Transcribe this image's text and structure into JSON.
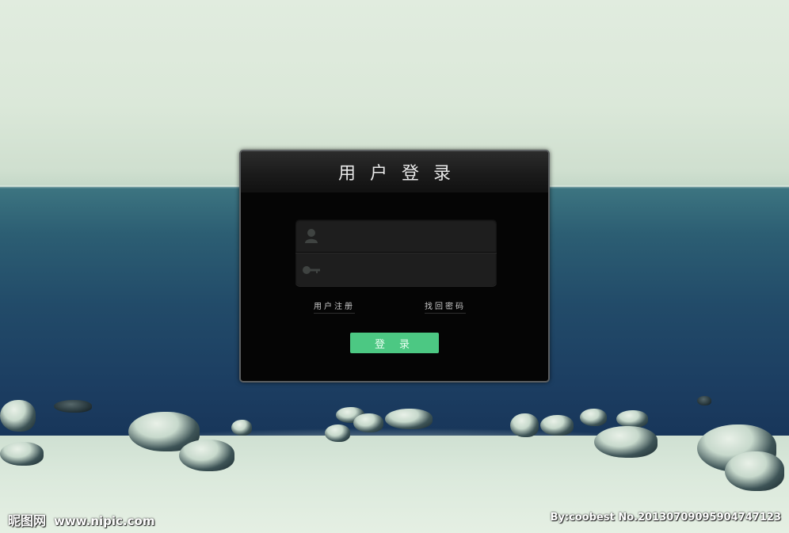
{
  "panel": {
    "title": "用户登录"
  },
  "form": {
    "username": {
      "value": "",
      "placeholder": "",
      "icon": "user-icon"
    },
    "password": {
      "value": "",
      "placeholder": "",
      "icon": "key-icon"
    }
  },
  "links": {
    "register": "用户注册",
    "forgot_password": "找回密码"
  },
  "login_button": "登录",
  "watermark": {
    "logo": "昵图网",
    "site": "www.nipic.com",
    "credit": "By:coobest  No.20130709095904747123"
  },
  "colors": {
    "panel_bg": "#050505",
    "button": "#4cc883",
    "field_bg": "#1e1e1e"
  }
}
